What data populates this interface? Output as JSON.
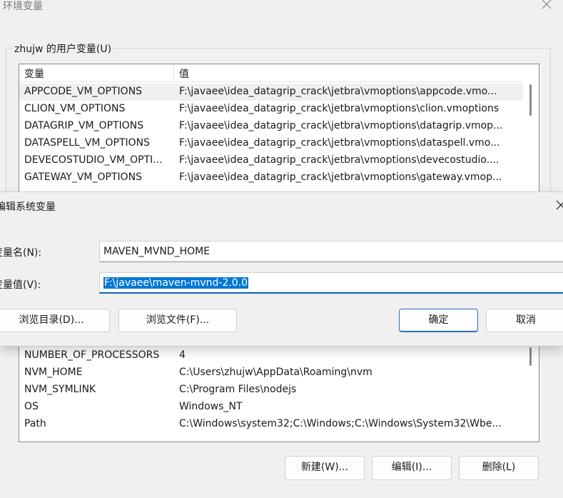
{
  "env_window": {
    "title": "环境变量",
    "user_vars_group": "zhujw 的用户变量(U)",
    "columns": {
      "name": "变量",
      "value": "值"
    },
    "user_vars": [
      {
        "name": "APPCODE_VM_OPTIONS",
        "value": "F:\\javaee\\idea_datagrip_crack\\jetbra\\vmoptions\\appcode.vmo..."
      },
      {
        "name": "CLION_VM_OPTIONS",
        "value": "F:\\javaee\\idea_datagrip_crack\\jetbra\\vmoptions\\clion.vmoptions"
      },
      {
        "name": "DATAGRIP_VM_OPTIONS",
        "value": "F:\\javaee\\idea_datagrip_crack\\jetbra\\vmoptions\\datagrip.vmop..."
      },
      {
        "name": "DATASPELL_VM_OPTIONS",
        "value": "F:\\javaee\\idea_datagrip_crack\\jetbra\\vmoptions\\dataspell.vmo..."
      },
      {
        "name": "DEVECOSTUDIO_VM_OPTI...",
        "value": "F:\\javaee\\idea_datagrip_crack\\jetbra\\vmoptions\\devecostudio...."
      },
      {
        "name": "GATEWAY_VM_OPTIONS",
        "value": "F:\\javaee\\idea_datagrip_crack\\jetbra\\vmoptions\\gateway.vmop..."
      }
    ],
    "system_vars": [
      {
        "name": "NUMBER_OF_PROCESSORS",
        "value": "4"
      },
      {
        "name": "NVM_HOME",
        "value": "C:\\Users\\zhujw\\AppData\\Roaming\\nvm"
      },
      {
        "name": "NVM_SYMLINK",
        "value": "C:\\Program Files\\nodejs"
      },
      {
        "name": "OS",
        "value": "Windows_NT"
      },
      {
        "name": "Path",
        "value": "C:\\Windows\\system32;C:\\Windows;C:\\Windows\\System32\\Wbe..."
      }
    ],
    "buttons": {
      "new": "新建(W)...",
      "edit": "编辑(I)...",
      "delete": "删除(L)"
    }
  },
  "edit_dialog": {
    "title": "编辑系统变量",
    "name_label": "变量名(N):",
    "name_value": "MAVEN_MVND_HOME",
    "value_label": "变量值(V):",
    "value_value": "F:\\javaee\\maven-mvnd-2.0.0",
    "buttons": {
      "browse_dir": "浏览目录(D)...",
      "browse_file": "浏览文件(F)...",
      "ok": "确定",
      "cancel": "取消"
    }
  },
  "colors": {
    "accent": "#0067c0",
    "selection": "#0078d4",
    "background": "#f0f0f0"
  }
}
